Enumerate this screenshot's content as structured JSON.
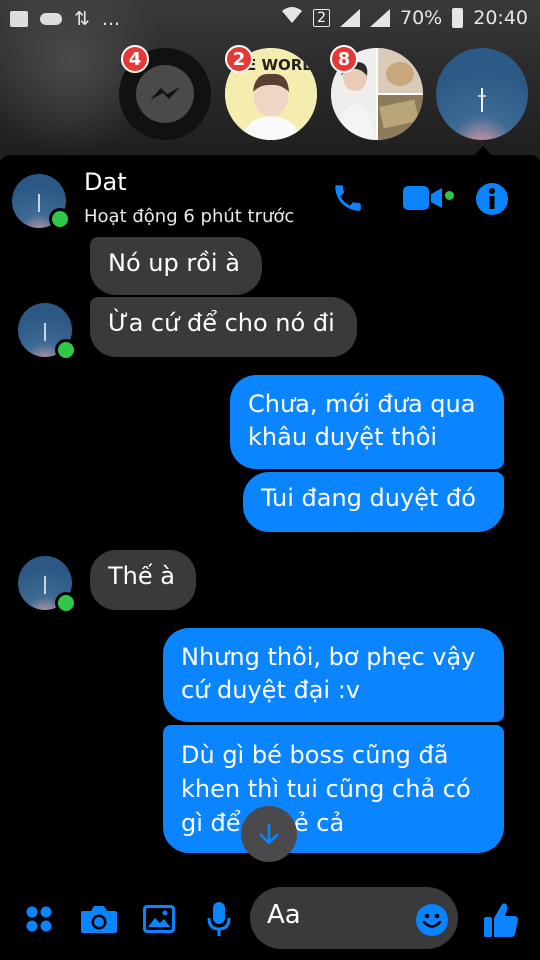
{
  "status_bar": {
    "dots": "...",
    "sim_slot": "2",
    "battery": "70%",
    "time": "20:40"
  },
  "chat_heads": [
    {
      "name": "messenger",
      "badge": "4"
    },
    {
      "name": "contact-2",
      "badge": "2",
      "overlay_text": "PE WORL"
    },
    {
      "name": "contact-3",
      "badge": "8"
    },
    {
      "name": "contact-dat",
      "badge": ""
    }
  ],
  "header": {
    "name": "Dat",
    "status": "Hoạt động 6 phút trước"
  },
  "messages": [
    {
      "from": "them",
      "text": "Nó up rồi à"
    },
    {
      "from": "them",
      "text": "Ừa cứ để cho nó đi"
    },
    {
      "from": "me",
      "lines": [
        "Chưa, mới đưa qua",
        "khâu duyệt thôi"
      ]
    },
    {
      "from": "me",
      "text": "Tui đang duyệt đó"
    },
    {
      "from": "them",
      "text": "Thế à"
    },
    {
      "from": "me",
      "lines": [
        "Nhưng thôi, bơ phẹc vậy",
        "cứ duyệt đại :v"
      ]
    },
    {
      "from": "me",
      "lines": [
        "Dù gì bé boss cũng đã",
        "khen thì tui cũng chả có",
        "gì để     bẻ cả"
      ]
    }
  ],
  "composer": {
    "placeholder": "Aa"
  },
  "colors": {
    "accent": "#0a84ff",
    "incoming_bubble": "#3a3a3c",
    "online": "#31c84a",
    "badge": "#e53935"
  }
}
